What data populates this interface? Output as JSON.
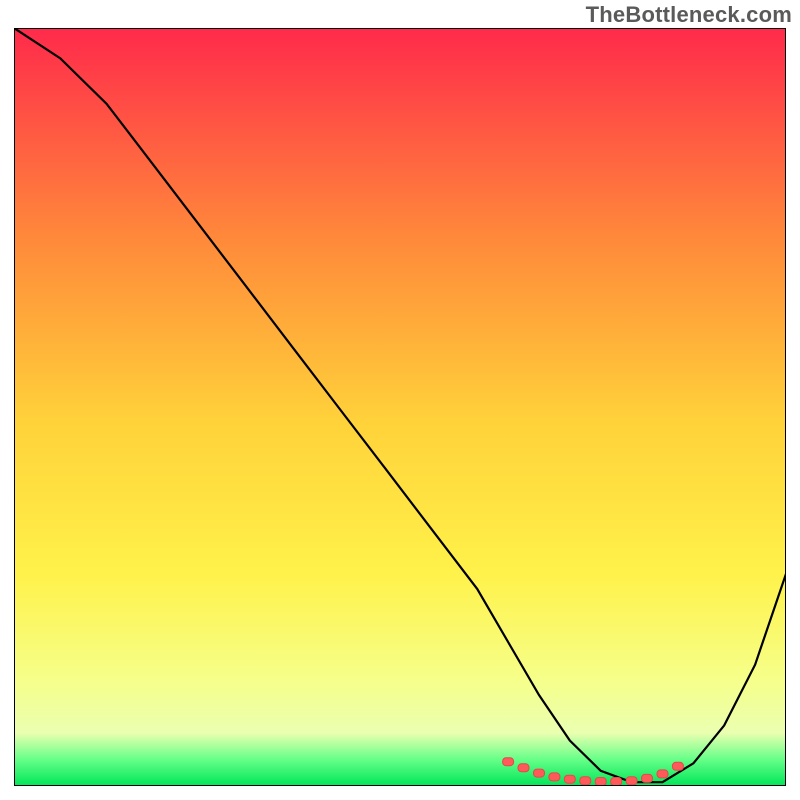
{
  "watermark": "TheBottleneck.com",
  "colors": {
    "gradient_top": "#ff2a4b",
    "gradient_mid1": "#ff8a3a",
    "gradient_mid2": "#ffd23a",
    "gradient_mid3": "#fff24a",
    "gradient_mid4": "#f6ff8a",
    "gradient_bottom_y": "#eaffb0",
    "gradient_green1": "#66ff88",
    "gradient_green2": "#00e658",
    "curve": "#000000",
    "marker_fill": "#ff5a5a",
    "marker_stroke": "#e14a4a",
    "border": "#000000"
  },
  "chart_data": {
    "type": "line",
    "title": "",
    "xlabel": "",
    "ylabel": "",
    "xlim": [
      0,
      100
    ],
    "ylim": [
      0,
      100
    ],
    "series": [
      {
        "name": "bottleneck-curve",
        "x": [
          0,
          6,
          12,
          18,
          24,
          30,
          36,
          42,
          48,
          54,
          60,
          64,
          68,
          72,
          76,
          80,
          84,
          88,
          92,
          96,
          100
        ],
        "y": [
          100,
          96,
          90,
          82,
          74,
          66,
          58,
          50,
          42,
          34,
          26,
          19,
          12,
          6,
          2,
          0.5,
          0.5,
          3,
          8,
          16,
          28
        ]
      }
    ],
    "markers": {
      "name": "optimal-range",
      "x": [
        64,
        66,
        68,
        70,
        72,
        74,
        76,
        78,
        80,
        82,
        84,
        86
      ],
      "y": [
        3.2,
        2.4,
        1.7,
        1.2,
        0.9,
        0.7,
        0.6,
        0.6,
        0.7,
        1.0,
        1.6,
        2.6
      ]
    }
  }
}
